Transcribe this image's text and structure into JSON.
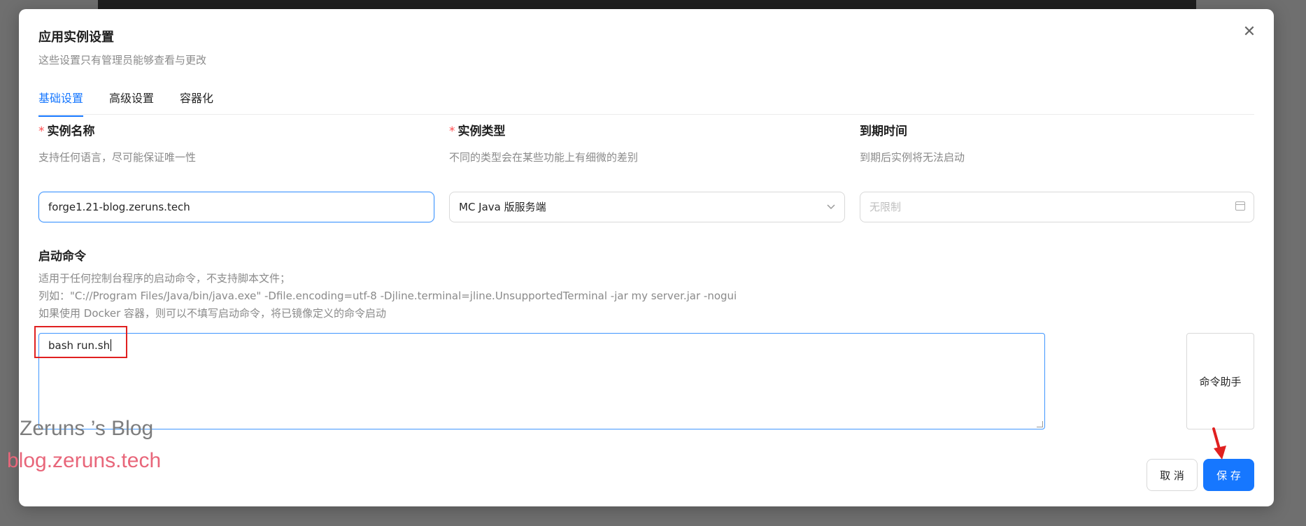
{
  "dialog": {
    "title": "应用实例设置",
    "subtitle": "这些设置只有管理员能够查看与更改",
    "close_icon": "close-icon"
  },
  "tabs": [
    {
      "label": "基础设置",
      "active": true
    },
    {
      "label": "高级设置",
      "active": false
    },
    {
      "label": "容器化",
      "active": false
    }
  ],
  "fields": {
    "name": {
      "label": "实例名称",
      "required": true,
      "help": "支持任何语言，尽可能保证唯一性",
      "value": "forge1.21-blog.zeruns.tech"
    },
    "type": {
      "label": "实例类型",
      "required": true,
      "help": "不同的类型会在某些功能上有细微的差别",
      "value": "MC Java 版服务端",
      "icon": "chevron-down-icon"
    },
    "expire": {
      "label": "到期时间",
      "required": false,
      "help": "到期后实例将无法启动",
      "placeholder": "无限制",
      "icon": "calendar-icon"
    }
  },
  "command": {
    "label": "启动命令",
    "help_lines": [
      "适用于任何控制台程序的启动命令，不支持脚本文件；",
      "列如：\"C://Program Files/Java/bin/java.exe\" -Dfile.encoding=utf-8 -Djline.terminal=jline.UnsupportedTerminal -jar my server.jar -nogui",
      "如果使用 Docker 容器，则可以不填写启动命令，将已镜像定义的命令启动"
    ],
    "value": "bash run.sh",
    "assistant_label": "命令助手"
  },
  "buttons": {
    "cancel": "取 消",
    "save": "保 存"
  },
  "watermark": {
    "line1": "Zeruns ’s Blog",
    "line2": "blog.zeruns.tech"
  },
  "colors": {
    "primary": "#1677ff",
    "required": "#ff4d4f",
    "annotation": "#e02020"
  }
}
